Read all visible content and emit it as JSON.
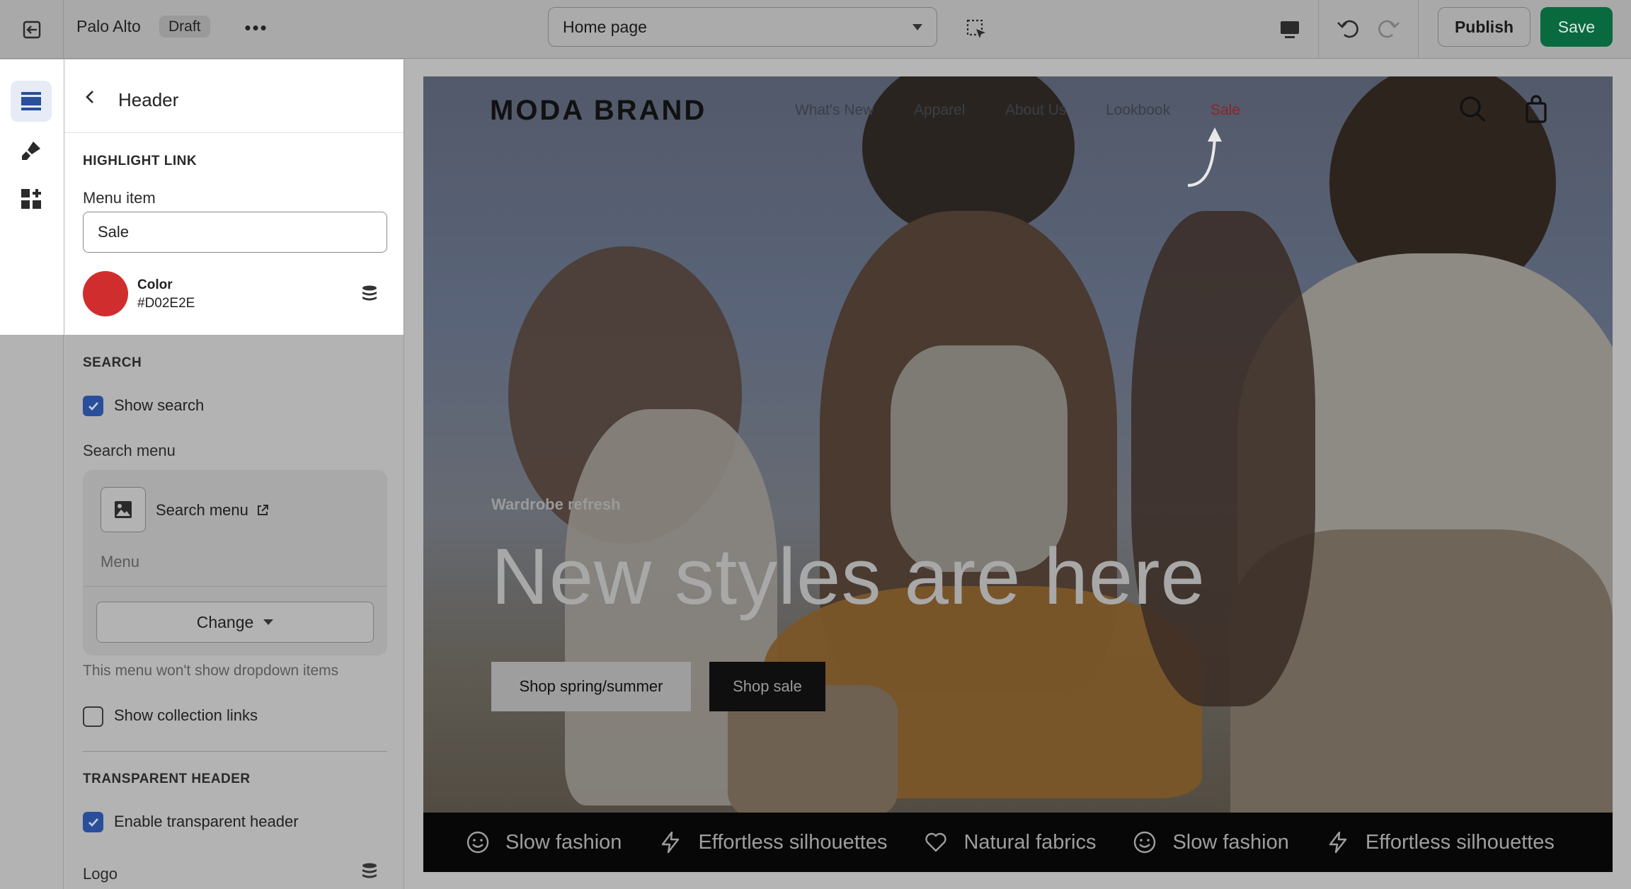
{
  "topbar": {
    "store_name": "Palo Alto",
    "status_badge": "Draft",
    "more_label": "•••",
    "page_selector": "Home page",
    "publish_label": "Publish",
    "save_label": "Save"
  },
  "rail": {
    "items": [
      {
        "icon": "sections-icon",
        "active": true
      },
      {
        "icon": "theme-settings-icon",
        "active": false
      },
      {
        "icon": "apps-icon",
        "active": false
      }
    ]
  },
  "panel": {
    "title": "Header",
    "highlight": {
      "section_title": "HIGHLIGHT LINK",
      "menu_item_label": "Menu item",
      "menu_item_value": "Sale",
      "color_label": "Color",
      "color_value": "#D02E2E"
    },
    "search": {
      "section_title": "SEARCH",
      "show_search_label": "Show search",
      "show_search_checked": true,
      "search_menu_label": "Search menu",
      "search_menu_link": "Search menu",
      "search_menu_sub": "Menu",
      "change_label": "Change",
      "note": "This menu won't show dropdown items",
      "show_collection_label": "Show collection links",
      "show_collection_checked": false
    },
    "transparent": {
      "section_title": "TRANSPARENT HEADER",
      "enable_label": "Enable transparent header",
      "enable_checked": true,
      "logo_label": "Logo"
    }
  },
  "preview": {
    "brand": "MODA BRAND",
    "nav": [
      "What's New",
      "Apparel",
      "About Us",
      "Lookbook",
      "Sale"
    ],
    "hero_kicker": "Wardrobe refresh",
    "hero_title": "New styles are here",
    "btn_primary": "Shop spring/summer",
    "btn_secondary": "Shop sale",
    "marquee": [
      {
        "icon": "smile-icon",
        "label": "Slow fashion"
      },
      {
        "icon": "bolt-icon",
        "label": "Effortless silhouettes"
      },
      {
        "icon": "heart-icon",
        "label": "Natural fabrics"
      },
      {
        "icon": "smile-icon",
        "label": "Slow fashion"
      },
      {
        "icon": "bolt-icon",
        "label": "Effortless silhouettes"
      }
    ]
  },
  "colors": {
    "highlight": "#D02E2E",
    "save": "#0a6a3f",
    "checkbox": "#2a4f9a"
  }
}
